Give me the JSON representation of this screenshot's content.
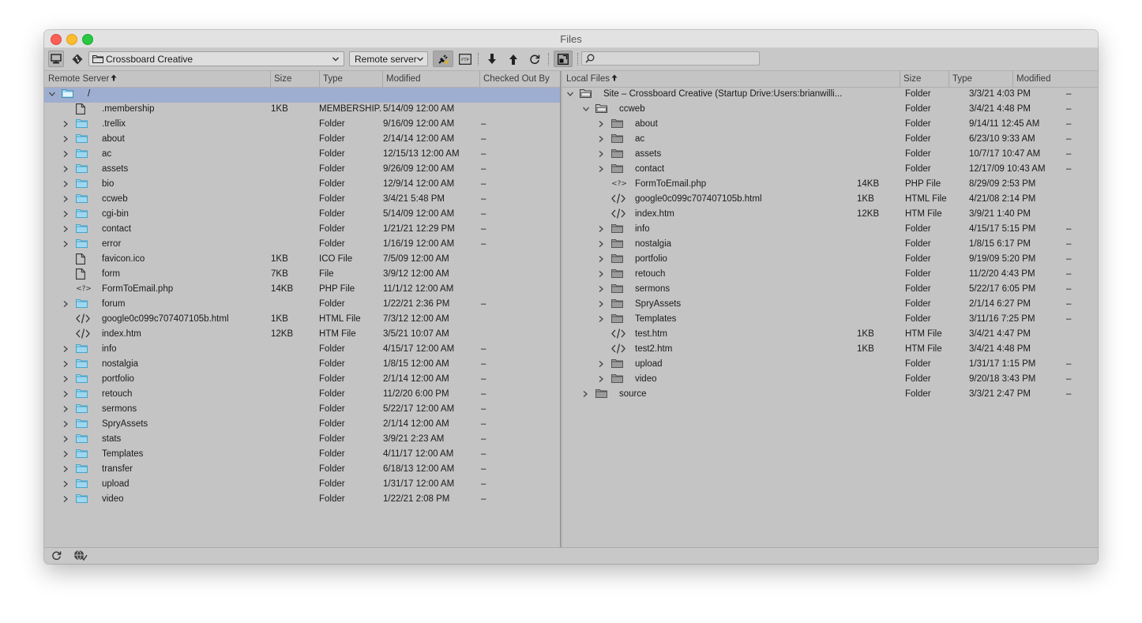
{
  "window": {
    "title": "Files"
  },
  "toolbar": {
    "site_select": "Crossboard Creative",
    "server_select": "Remote server",
    "search_placeholder": ""
  },
  "left": {
    "columns": [
      {
        "label": "Remote Server"
      },
      {
        "label": "Size"
      },
      {
        "label": "Type"
      },
      {
        "label": "Modified"
      },
      {
        "label": "Checked Out By"
      }
    ],
    "rows": [
      {
        "name": "/",
        "size": "",
        "type": "",
        "modified": "",
        "checked": "",
        "icon": "folder-open",
        "expand": "down",
        "indent": 0,
        "selected": true
      },
      {
        "name": ".membership",
        "size": "1KB",
        "type": "MEMBERSHIP...",
        "modified": "5/14/09 12:00 AM",
        "checked": "",
        "icon": "file",
        "expand": "",
        "indent": 1
      },
      {
        "name": ".trellix",
        "size": "",
        "type": "Folder",
        "modified": "9/16/09 12:00 AM",
        "checked": "–",
        "icon": "folder",
        "expand": "right",
        "indent": 1
      },
      {
        "name": "about",
        "size": "",
        "type": "Folder",
        "modified": "2/14/14 12:00 AM",
        "checked": "–",
        "icon": "folder",
        "expand": "right",
        "indent": 1
      },
      {
        "name": "ac",
        "size": "",
        "type": "Folder",
        "modified": "12/15/13 12:00 AM",
        "checked": "–",
        "icon": "folder",
        "expand": "right",
        "indent": 1
      },
      {
        "name": "assets",
        "size": "",
        "type": "Folder",
        "modified": "9/26/09 12:00 AM",
        "checked": "–",
        "icon": "folder",
        "expand": "right",
        "indent": 1
      },
      {
        "name": "bio",
        "size": "",
        "type": "Folder",
        "modified": "12/9/14 12:00 AM",
        "checked": "–",
        "icon": "folder",
        "expand": "right",
        "indent": 1
      },
      {
        "name": "ccweb",
        "size": "",
        "type": "Folder",
        "modified": "3/4/21 5:48 PM",
        "checked": "–",
        "icon": "folder",
        "expand": "right",
        "indent": 1
      },
      {
        "name": "cgi-bin",
        "size": "",
        "type": "Folder",
        "modified": "5/14/09 12:00 AM",
        "checked": "–",
        "icon": "folder",
        "expand": "right",
        "indent": 1
      },
      {
        "name": "contact",
        "size": "",
        "type": "Folder",
        "modified": "1/21/21 12:29 PM",
        "checked": "–",
        "icon": "folder",
        "expand": "right",
        "indent": 1
      },
      {
        "name": "error",
        "size": "",
        "type": "Folder",
        "modified": "1/16/19 12:00 AM",
        "checked": "–",
        "icon": "folder",
        "expand": "right",
        "indent": 1
      },
      {
        "name": "favicon.ico",
        "size": "1KB",
        "type": "ICO File",
        "modified": "7/5/09 12:00 AM",
        "checked": "",
        "icon": "file",
        "expand": "",
        "indent": 1
      },
      {
        "name": "form",
        "size": "7KB",
        "type": "File",
        "modified": "3/9/12 12:00 AM",
        "checked": "",
        "icon": "file",
        "expand": "",
        "indent": 1
      },
      {
        "name": "FormToEmail.php",
        "size": "14KB",
        "type": "PHP File",
        "modified": "11/1/12 12:00 AM",
        "checked": "",
        "icon": "php",
        "expand": "",
        "indent": 1
      },
      {
        "name": "forum",
        "size": "",
        "type": "Folder",
        "modified": "1/22/21 2:36 PM",
        "checked": "–",
        "icon": "folder",
        "expand": "right",
        "indent": 1
      },
      {
        "name": "google0c099c707407105b.html",
        "size": "1KB",
        "type": "HTML File",
        "modified": "7/3/12 12:00 AM",
        "checked": "",
        "icon": "code",
        "expand": "",
        "indent": 1
      },
      {
        "name": "index.htm",
        "size": "12KB",
        "type": "HTM File",
        "modified": "3/5/21 10:07 AM",
        "checked": "",
        "icon": "code",
        "expand": "",
        "indent": 1
      },
      {
        "name": "info",
        "size": "",
        "type": "Folder",
        "modified": "4/15/17 12:00 AM",
        "checked": "–",
        "icon": "folder",
        "expand": "right",
        "indent": 1
      },
      {
        "name": "nostalgia",
        "size": "",
        "type": "Folder",
        "modified": "1/8/15 12:00 AM",
        "checked": "–",
        "icon": "folder",
        "expand": "right",
        "indent": 1
      },
      {
        "name": "portfolio",
        "size": "",
        "type": "Folder",
        "modified": "2/1/14 12:00 AM",
        "checked": "–",
        "icon": "folder",
        "expand": "right",
        "indent": 1
      },
      {
        "name": "retouch",
        "size": "",
        "type": "Folder",
        "modified": "11/2/20 6:00 PM",
        "checked": "–",
        "icon": "folder",
        "expand": "right",
        "indent": 1
      },
      {
        "name": "sermons",
        "size": "",
        "type": "Folder",
        "modified": "5/22/17 12:00 AM",
        "checked": "–",
        "icon": "folder",
        "expand": "right",
        "indent": 1
      },
      {
        "name": "SpryAssets",
        "size": "",
        "type": "Folder",
        "modified": "2/1/14 12:00 AM",
        "checked": "–",
        "icon": "folder",
        "expand": "right",
        "indent": 1
      },
      {
        "name": "stats",
        "size": "",
        "type": "Folder",
        "modified": "3/9/21 2:23 AM",
        "checked": "–",
        "icon": "folder",
        "expand": "right",
        "indent": 1
      },
      {
        "name": "Templates",
        "size": "",
        "type": "Folder",
        "modified": "4/11/17 12:00 AM",
        "checked": "–",
        "icon": "folder",
        "expand": "right",
        "indent": 1
      },
      {
        "name": "transfer",
        "size": "",
        "type": "Folder",
        "modified": "6/18/13 12:00 AM",
        "checked": "–",
        "icon": "folder",
        "expand": "right",
        "indent": 1
      },
      {
        "name": "upload",
        "size": "",
        "type": "Folder",
        "modified": "1/31/17 12:00 AM",
        "checked": "–",
        "icon": "folder",
        "expand": "right",
        "indent": 1
      },
      {
        "name": "video",
        "size": "",
        "type": "Folder",
        "modified": "1/22/21 2:08 PM",
        "checked": "–",
        "icon": "folder",
        "expand": "right",
        "indent": 1
      }
    ]
  },
  "right": {
    "columns": [
      {
        "label": "Local Files"
      },
      {
        "label": "Size"
      },
      {
        "label": "Type"
      },
      {
        "label": "Modified"
      },
      {
        "label": "Che..."
      }
    ],
    "rows": [
      {
        "name": "Site – Crossboard Creative (Startup Drive:Users:brianwilli...",
        "size": "",
        "type": "Folder",
        "modified": "3/3/21 4:03 PM",
        "checked": "–",
        "icon": "gfolder-open",
        "expand": "down",
        "indent": 0
      },
      {
        "name": "ccweb",
        "size": "",
        "type": "Folder",
        "modified": "3/4/21 4:48 PM",
        "checked": "–",
        "icon": "gfolder-open",
        "expand": "down",
        "indent": 1
      },
      {
        "name": "about",
        "size": "",
        "type": "Folder",
        "modified": "9/14/11 12:45 AM",
        "checked": "–",
        "icon": "gfolder",
        "expand": "right",
        "indent": 2
      },
      {
        "name": "ac",
        "size": "",
        "type": "Folder",
        "modified": "6/23/10 9:33 AM",
        "checked": "–",
        "icon": "gfolder",
        "expand": "right",
        "indent": 2
      },
      {
        "name": "assets",
        "size": "",
        "type": "Folder",
        "modified": "10/7/17 10:47 AM",
        "checked": "–",
        "icon": "gfolder",
        "expand": "right",
        "indent": 2
      },
      {
        "name": "contact",
        "size": "",
        "type": "Folder",
        "modified": "12/17/09 10:43 AM",
        "checked": "–",
        "icon": "gfolder",
        "expand": "right",
        "indent": 2
      },
      {
        "name": "FormToEmail.php",
        "size": "14KB",
        "type": "PHP File",
        "modified": "8/29/09 2:53 PM",
        "checked": "",
        "icon": "php",
        "expand": "",
        "indent": 2
      },
      {
        "name": "google0c099c707407105b.html",
        "size": "1KB",
        "type": "HTML File",
        "modified": "4/21/08 2:14 PM",
        "checked": "",
        "icon": "code",
        "expand": "",
        "indent": 2
      },
      {
        "name": "index.htm",
        "size": "12KB",
        "type": "HTM File",
        "modified": "3/9/21 1:40 PM",
        "checked": "",
        "icon": "code",
        "expand": "",
        "indent": 2
      },
      {
        "name": "info",
        "size": "",
        "type": "Folder",
        "modified": "4/15/17 5:15 PM",
        "checked": "–",
        "icon": "gfolder",
        "expand": "right",
        "indent": 2
      },
      {
        "name": "nostalgia",
        "size": "",
        "type": "Folder",
        "modified": "1/8/15 6:17 PM",
        "checked": "–",
        "icon": "gfolder",
        "expand": "right",
        "indent": 2
      },
      {
        "name": "portfolio",
        "size": "",
        "type": "Folder",
        "modified": "9/19/09 5:20 PM",
        "checked": "–",
        "icon": "gfolder",
        "expand": "right",
        "indent": 2
      },
      {
        "name": "retouch",
        "size": "",
        "type": "Folder",
        "modified": "11/2/20 4:43 PM",
        "checked": "–",
        "icon": "gfolder",
        "expand": "right",
        "indent": 2
      },
      {
        "name": "sermons",
        "size": "",
        "type": "Folder",
        "modified": "5/22/17 6:05 PM",
        "checked": "–",
        "icon": "gfolder",
        "expand": "right",
        "indent": 2
      },
      {
        "name": "SpryAssets",
        "size": "",
        "type": "Folder",
        "modified": "2/1/14 6:27 PM",
        "checked": "–",
        "icon": "gfolder",
        "expand": "right",
        "indent": 2
      },
      {
        "name": "Templates",
        "size": "",
        "type": "Folder",
        "modified": "3/11/16 7:25 PM",
        "checked": "–",
        "icon": "gfolder",
        "expand": "right",
        "indent": 2
      },
      {
        "name": "test.htm",
        "size": "1KB",
        "type": "HTM File",
        "modified": "3/4/21 4:47 PM",
        "checked": "",
        "icon": "code",
        "expand": "",
        "indent": 2
      },
      {
        "name": "test2.htm",
        "size": "1KB",
        "type": "HTM File",
        "modified": "3/4/21 4:48 PM",
        "checked": "",
        "icon": "code",
        "expand": "",
        "indent": 2
      },
      {
        "name": "upload",
        "size": "",
        "type": "Folder",
        "modified": "1/31/17 1:15 PM",
        "checked": "–",
        "icon": "gfolder",
        "expand": "right",
        "indent": 2
      },
      {
        "name": "video",
        "size": "",
        "type": "Folder",
        "modified": "9/20/18 3:43 PM",
        "checked": "–",
        "icon": "gfolder",
        "expand": "right",
        "indent": 2
      },
      {
        "name": "source",
        "size": "",
        "type": "Folder",
        "modified": "3/3/21 2:47 PM",
        "checked": "–",
        "icon": "gfolder",
        "expand": "right",
        "indent": 1
      }
    ]
  },
  "colors": {
    "folder_blue": "#7dc6e4",
    "selection": "#9eaed0",
    "window_bg": "#c4c4c4"
  }
}
